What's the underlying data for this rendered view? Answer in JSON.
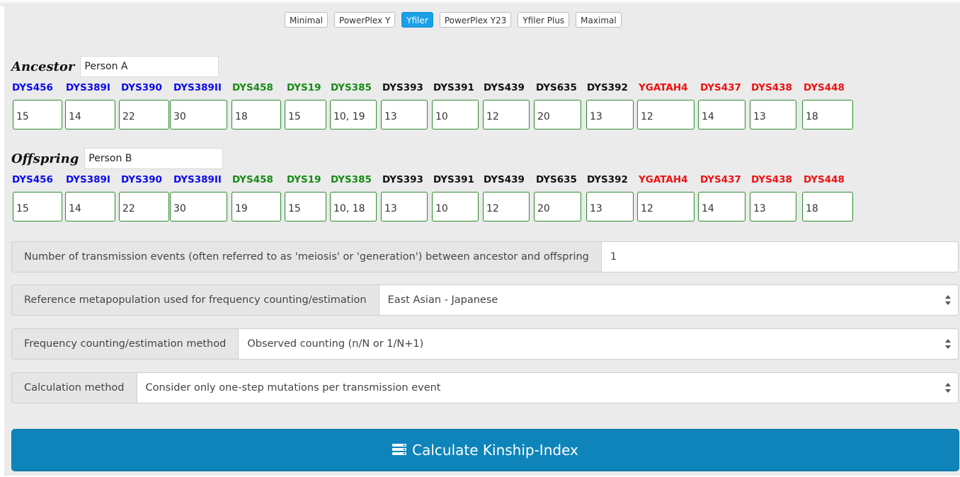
{
  "presets": [
    "Minimal",
    "PowerPlex Y",
    "Yfiler",
    "PowerPlex Y23",
    "Yfiler Plus",
    "Maximal"
  ],
  "active_preset": "Yfiler",
  "colors": {
    "blue": "#0a0aee",
    "green": "#178a17",
    "black": "#111111",
    "red": "#ee1111",
    "accent": "#1aa0e6",
    "button": "#0f84ba",
    "input_border": "#2e8b2e"
  },
  "markers": [
    {
      "name": "DYS456",
      "color": "blue"
    },
    {
      "name": "DYS389I",
      "color": "blue"
    },
    {
      "name": "DYS390",
      "color": "blue"
    },
    {
      "name": "DYS389II",
      "color": "blue"
    },
    {
      "name": "DYS458",
      "color": "green"
    },
    {
      "name": "DYS19",
      "color": "green"
    },
    {
      "name": "DYS385",
      "color": "green"
    },
    {
      "name": "DYS393",
      "color": "black"
    },
    {
      "name": "DYS391",
      "color": "black"
    },
    {
      "name": "DYS439",
      "color": "black"
    },
    {
      "name": "DYS635",
      "color": "black"
    },
    {
      "name": "DYS392",
      "color": "black"
    },
    {
      "name": "YGATAH4",
      "color": "red"
    },
    {
      "name": "DYS437",
      "color": "red"
    },
    {
      "name": "DYS438",
      "color": "red"
    },
    {
      "name": "DYS448",
      "color": "red"
    }
  ],
  "ancestor": {
    "title": "Ancestor",
    "name": "Person A",
    "values": [
      "15",
      "14",
      "22",
      "30",
      "18",
      "15",
      "10, 19",
      "13",
      "10",
      "12",
      "20",
      "13",
      "12",
      "14",
      "13",
      "18"
    ]
  },
  "offspring": {
    "title": "Offspring",
    "name": "Person B",
    "values": [
      "15",
      "14",
      "22",
      "30",
      "19",
      "15",
      "10, 18",
      "13",
      "10",
      "12",
      "20",
      "13",
      "12",
      "14",
      "13",
      "18"
    ]
  },
  "form": {
    "transmission_label": "Number of transmission events (often referred to as 'meiosis' or 'generation') between ancestor and offspring",
    "transmission_value": "1",
    "metapopulation_label": "Reference metapopulation used for frequency counting/estimation",
    "metapopulation_value": "East Asian - Japanese",
    "frequency_label": "Frequency counting/estimation method",
    "frequency_value": "Observed counting (n/N or 1/N+1)",
    "calc_method_label": "Calculation method",
    "calc_method_value": "Consider only one-step mutations per transmission event"
  },
  "calculate_label": "Calculate Kinship-Index"
}
